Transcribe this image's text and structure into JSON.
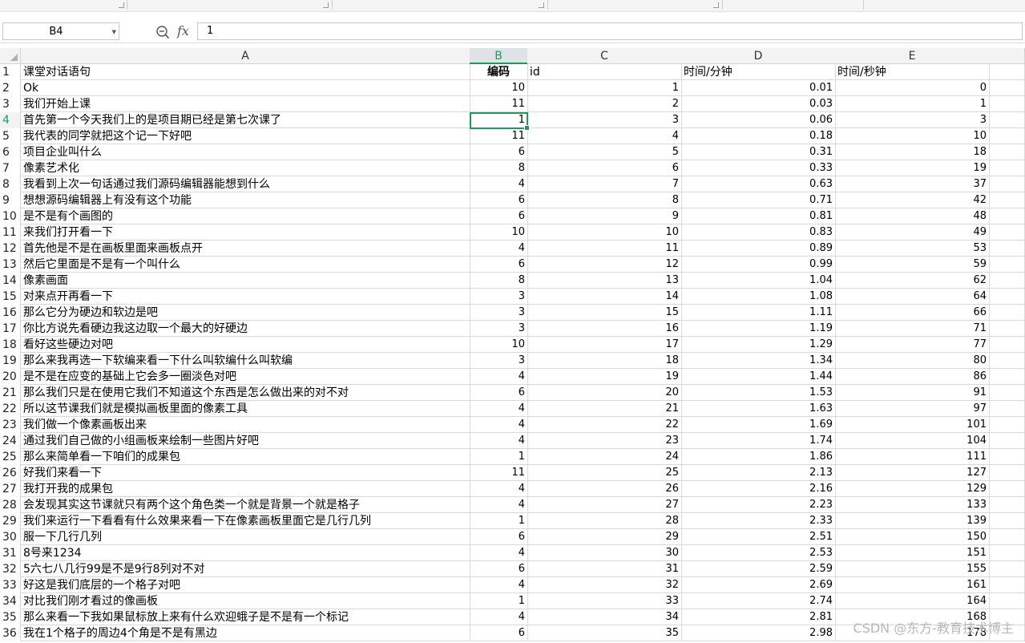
{
  "formula_bar": {
    "name_box": "B4",
    "fx_label": "fx",
    "value": "1"
  },
  "columns": [
    "A",
    "B",
    "C",
    "D",
    "E"
  ],
  "rows": [
    {
      "num": "1",
      "a": "课堂对话语句",
      "b": "编码",
      "c": "id",
      "d": "时间/分钟",
      "e": "时间/秒钟"
    },
    {
      "num": "2",
      "a": "Ok",
      "b": "10",
      "c": "1",
      "d": "0.01",
      "e": "0"
    },
    {
      "num": "3",
      "a": "我们开始上课",
      "b": "11",
      "c": "2",
      "d": "0.03",
      "e": "1"
    },
    {
      "num": "4",
      "a": "首先第一个今天我们上的是项目期已经是第七次课了",
      "b": "1",
      "c": "3",
      "d": "0.06",
      "e": "3"
    },
    {
      "num": "5",
      "a": "我代表的同学就把这个记一下好吧",
      "b": "11",
      "c": "4",
      "d": "0.18",
      "e": "10"
    },
    {
      "num": "6",
      "a": "项目企业叫什么",
      "b": "6",
      "c": "5",
      "d": "0.31",
      "e": "18"
    },
    {
      "num": "7",
      "a": "像素艺术化",
      "b": "8",
      "c": "6",
      "d": "0.33",
      "e": "19"
    },
    {
      "num": "8",
      "a": "我看到上次一句话通过我们源码编辑器能想到什么",
      "b": "4",
      "c": "7",
      "d": "0.63",
      "e": "37"
    },
    {
      "num": "9",
      "a": "想想源码编辑器上有没有这个功能",
      "b": "6",
      "c": "8",
      "d": "0.71",
      "e": "42"
    },
    {
      "num": "10",
      "a": "是不是有个画图的",
      "b": "6",
      "c": "9",
      "d": "0.81",
      "e": "48"
    },
    {
      "num": "11",
      "a": "来我们打开看一下",
      "b": "10",
      "c": "10",
      "d": "0.83",
      "e": "49"
    },
    {
      "num": "12",
      "a": "首先他是不是在画板里面来画板点开",
      "b": "4",
      "c": "11",
      "d": "0.89",
      "e": "53"
    },
    {
      "num": "13",
      "a": "然后它里面是不是有一个叫什么",
      "b": "6",
      "c": "12",
      "d": "0.99",
      "e": "59"
    },
    {
      "num": "14",
      "a": "像素画面",
      "b": "8",
      "c": "13",
      "d": "1.04",
      "e": "62"
    },
    {
      "num": "15",
      "a": "对来点开再看一下",
      "b": "3",
      "c": "14",
      "d": "1.08",
      "e": "64"
    },
    {
      "num": "16",
      "a": "那么它分为硬边和软边是吧",
      "b": "3",
      "c": "15",
      "d": "1.11",
      "e": "66"
    },
    {
      "num": "17",
      "a": "你比方说先看硬边我这边取一个最大的好硬边",
      "b": "3",
      "c": "16",
      "d": "1.19",
      "e": "71"
    },
    {
      "num": "18",
      "a": "看好这些硬边对吧",
      "b": "10",
      "c": "17",
      "d": "1.29",
      "e": "77"
    },
    {
      "num": "19",
      "a": "那么来我再选一下软编来看一下什么叫软编什么叫软编",
      "b": "3",
      "c": "18",
      "d": "1.34",
      "e": "80"
    },
    {
      "num": "20",
      "a": "是不是在应变的基础上它会多一圈淡色对吧",
      "b": "4",
      "c": "19",
      "d": "1.44",
      "e": "86"
    },
    {
      "num": "21",
      "a": "那么我们只是在使用它我们不知道这个东西是怎么做出来的对不对",
      "b": "6",
      "c": "20",
      "d": "1.53",
      "e": "91"
    },
    {
      "num": "22",
      "a": "所以这节课我们就是模拟画板里面的像素工具",
      "b": "4",
      "c": "21",
      "d": "1.63",
      "e": "97"
    },
    {
      "num": "23",
      "a": "我们做一个像素画板出来",
      "b": "4",
      "c": "22",
      "d": "1.69",
      "e": "101"
    },
    {
      "num": "24",
      "a": "通过我们自己做的小组画板来绘制一些图片好吧",
      "b": "4",
      "c": "23",
      "d": "1.74",
      "e": "104"
    },
    {
      "num": "25",
      "a": "那么来简单看一下咱们的成果包",
      "b": "1",
      "c": "24",
      "d": "1.86",
      "e": "111"
    },
    {
      "num": "26",
      "a": "好我们来看一下",
      "b": "11",
      "c": "25",
      "d": "2.13",
      "e": "127"
    },
    {
      "num": "27",
      "a": "我打开我的成果包",
      "b": "4",
      "c": "26",
      "d": "2.16",
      "e": "129"
    },
    {
      "num": "28",
      "a": "会发现其实这节课就只有两个这个角色类一个就是背景一个就是格子",
      "b": "4",
      "c": "27",
      "d": "2.23",
      "e": "133"
    },
    {
      "num": "29",
      "a": "我们来运行一下看看有什么效果来看一下在像素画板里面它是几行几列",
      "b": "1",
      "c": "28",
      "d": "2.33",
      "e": "139"
    },
    {
      "num": "30",
      "a": "服一下几行几列",
      "b": "6",
      "c": "29",
      "d": "2.51",
      "e": "150"
    },
    {
      "num": "31",
      "a": "8号来1234",
      "b": "4",
      "c": "30",
      "d": "2.53",
      "e": "151"
    },
    {
      "num": "32",
      "a": "5六七八几行99是不是9行8列对不对",
      "b": "6",
      "c": "31",
      "d": "2.59",
      "e": "155"
    },
    {
      "num": "33",
      "a": "好这是我们底层的一个格子对吧",
      "b": "4",
      "c": "32",
      "d": "2.69",
      "e": "161"
    },
    {
      "num": "34",
      "a": "对比我们刚才看过的像画板",
      "b": "1",
      "c": "33",
      "d": "2.74",
      "e": "164"
    },
    {
      "num": "35",
      "a": "那么来看一下我如果鼠标放上来有什么欢迎蛾子是不是有一个标记",
      "b": "4",
      "c": "34",
      "d": "2.81",
      "e": "168"
    },
    {
      "num": "36",
      "a": "我在1个格子的周边4个角是不是有黑边",
      "b": "6",
      "c": "35",
      "d": "2.98",
      "e": "178"
    }
  ],
  "watermark": "CSDN @东方-教育技术博主",
  "colors": {
    "accent": "#1e9b5b",
    "grid": "#d9d9d9",
    "header_bg": "#f3f3f3"
  }
}
